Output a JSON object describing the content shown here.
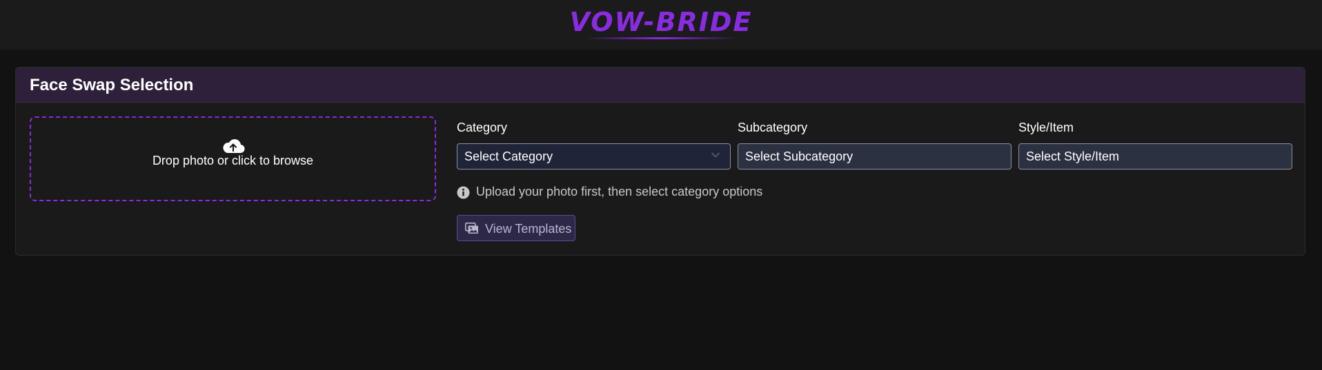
{
  "header": {
    "logo_text": "VOW-BRIDE"
  },
  "card": {
    "title": "Face Swap Selection"
  },
  "dropzone": {
    "icon": "cloud-upload-icon",
    "text": "Drop photo or click to browse"
  },
  "fields": {
    "category": {
      "label": "Category",
      "value": "Select Category"
    },
    "subcategory": {
      "label": "Subcategory",
      "value": "Select Subcategory"
    },
    "style": {
      "label": "Style/Item",
      "value": "Select Style/Item"
    }
  },
  "info": {
    "icon": "info-icon",
    "text": "Upload your photo first, then select category options"
  },
  "templates_button": {
    "icon": "images-icon",
    "label": "View Templates"
  },
  "colors": {
    "accent": "#8a2be2",
    "background": "#121212",
    "card_header": "#2e1f3a"
  }
}
